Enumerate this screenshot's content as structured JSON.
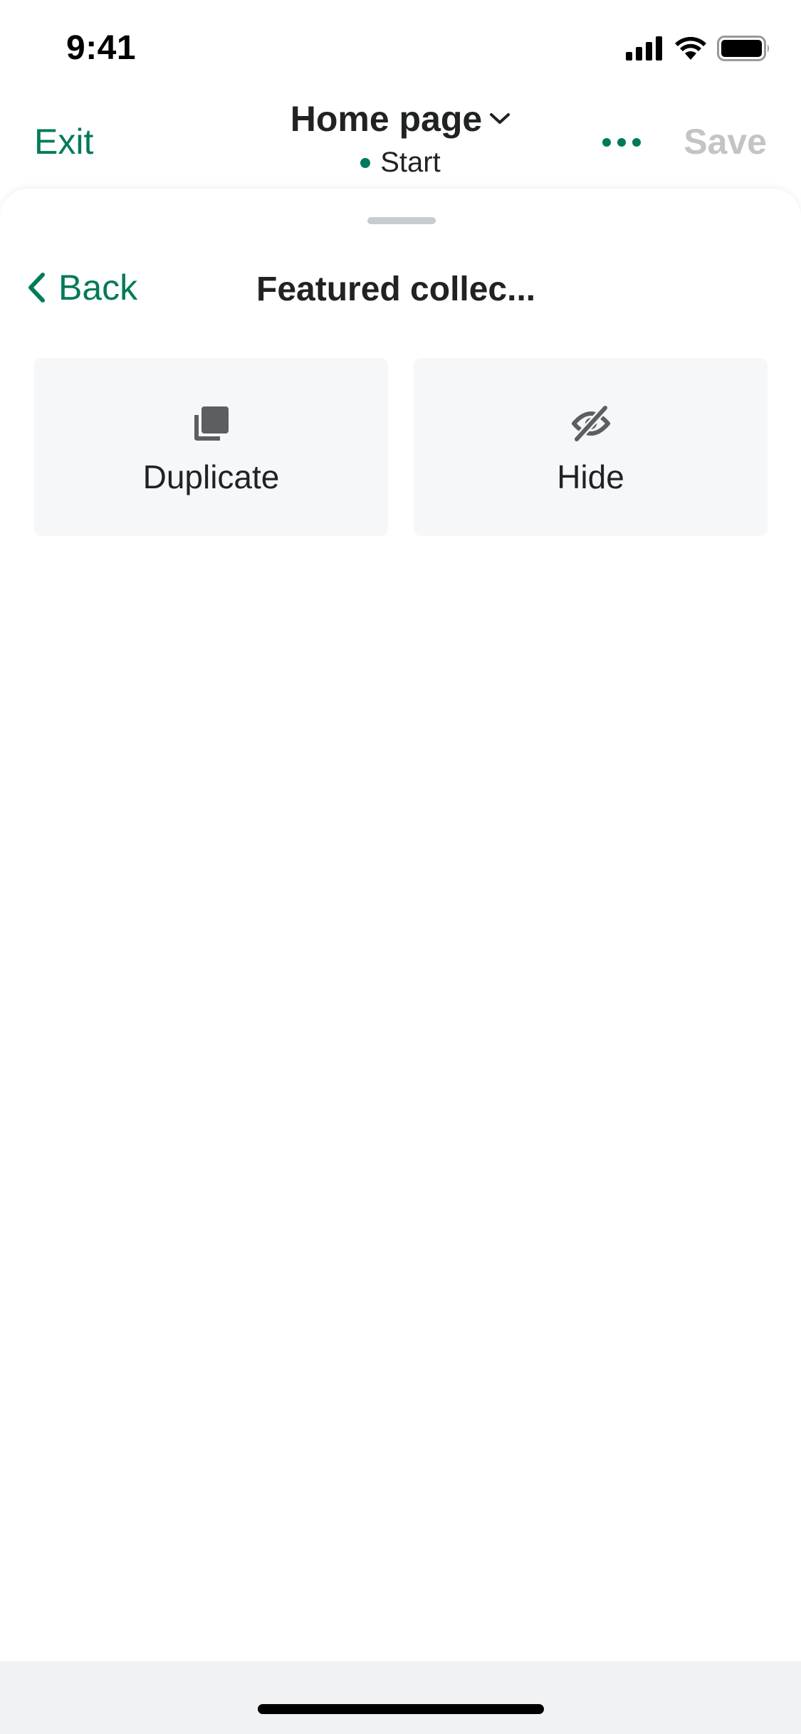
{
  "status_bar": {
    "time": "9:41",
    "icons": [
      "cellular-signal-icon",
      "wifi-icon",
      "battery-icon"
    ]
  },
  "nav": {
    "exit_label": "Exit",
    "title": "Home page",
    "subtitle": "Start",
    "more_icon": "more-horizontal-icon",
    "save_label": "Save"
  },
  "sheet": {
    "back_label": "Back",
    "title": "Featured collec...",
    "actions": [
      {
        "label": "Duplicate",
        "icon": "duplicate-icon"
      },
      {
        "label": "Hide",
        "icon": "hide-icon"
      }
    ]
  },
  "colors": {
    "accent": "#007a5a",
    "disabled_text": "#c4c4c4",
    "card_bg": "#f6f7f9",
    "icon_gray": "#5c5f62"
  }
}
